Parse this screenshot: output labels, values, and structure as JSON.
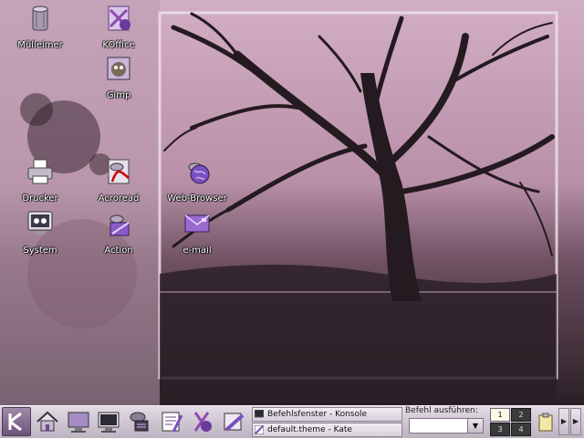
{
  "desktop": {
    "icons": [
      {
        "label": "Mülleimer",
        "icon": "trash-icon"
      },
      {
        "label": "KOffice",
        "icon": "koffice-icon"
      },
      {
        "label": "Gimp",
        "icon": "gimp-icon"
      },
      {
        "label": "Drucker",
        "icon": "printer-icon"
      },
      {
        "label": "Acroread",
        "icon": "acroread-icon"
      },
      {
        "label": "Web-Browser",
        "icon": "web-browser-icon"
      },
      {
        "label": "System",
        "icon": "system-monitor-icon"
      },
      {
        "label": "Action",
        "icon": "action-icon"
      },
      {
        "label": "e-mail",
        "icon": "email-icon"
      }
    ]
  },
  "panel": {
    "launchers": [
      {
        "icon": "k-menu-icon"
      },
      {
        "icon": "home-icon"
      },
      {
        "icon": "desktop-show-icon"
      },
      {
        "icon": "terminal-icon"
      },
      {
        "icon": "package-icon"
      },
      {
        "icon": "kwrite-icon"
      },
      {
        "icon": "koffice-icon"
      },
      {
        "icon": "kword-icon"
      }
    ],
    "tasks": [
      {
        "label": "Befehlsfenster - Konsole",
        "icon": "konsole-icon"
      },
      {
        "label": "default.theme - Kate",
        "icon": "kate-icon"
      }
    ],
    "run_command": {
      "label": "Befehl ausführen:",
      "value": ""
    },
    "pager": {
      "desktops": [
        "1",
        "2",
        "3",
        "4"
      ],
      "active": "1"
    }
  },
  "colors": {
    "accent": "#8e6aa6",
    "panel": "#cfc6d3"
  }
}
